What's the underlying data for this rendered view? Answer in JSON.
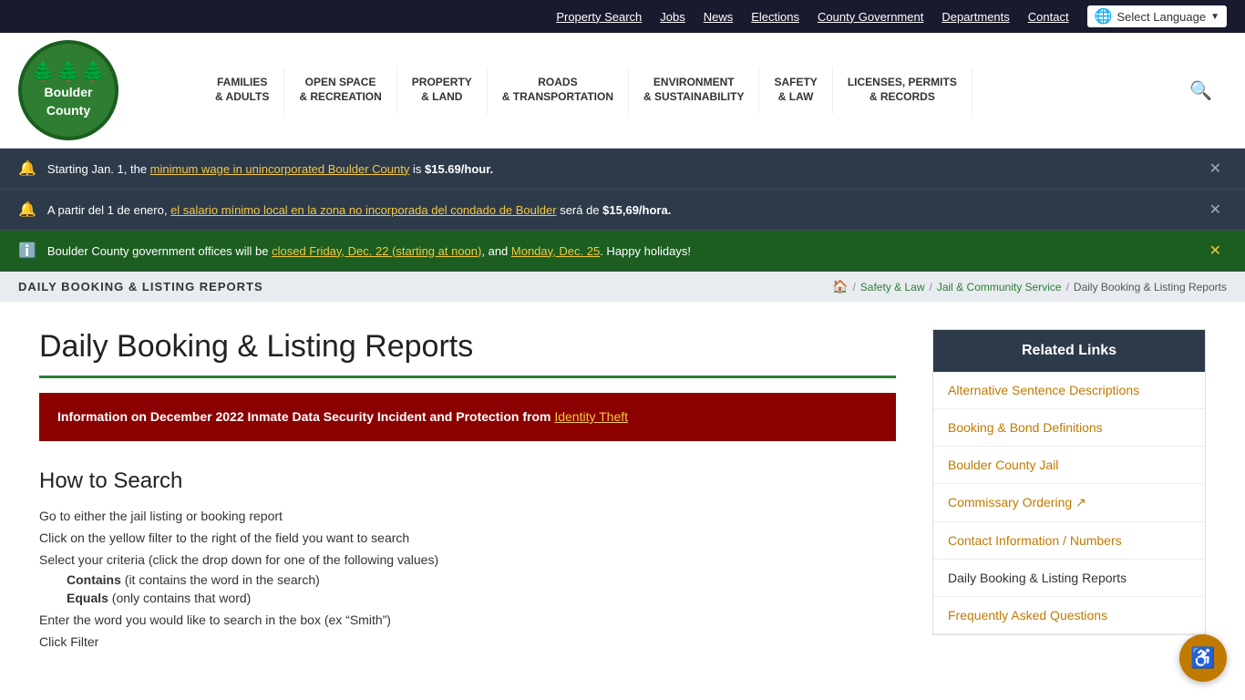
{
  "topNav": {
    "links": [
      {
        "label": "Property Search",
        "href": "#"
      },
      {
        "label": "Jobs",
        "href": "#"
      },
      {
        "label": "News",
        "href": "#"
      },
      {
        "label": "Elections",
        "href": "#"
      },
      {
        "label": "County Government",
        "href": "#"
      },
      {
        "label": "Departments",
        "href": "#"
      },
      {
        "label": "Contact",
        "href": "#"
      }
    ],
    "languageSelector": "Select Language"
  },
  "logo": {
    "line1": "Boulder",
    "line2": "County"
  },
  "mainNav": {
    "items": [
      {
        "line1": "FAMILIES",
        "line2": "& ADULTS"
      },
      {
        "line1": "OPEN SPACE",
        "line2": "& RECREATION"
      },
      {
        "line1": "PROPERTY",
        "line2": "& LAND"
      },
      {
        "line1": "ROADS",
        "line2": "& TRANSPORTATION"
      },
      {
        "line1": "ENVIRONMENT",
        "line2": "& SUSTAINABILITY"
      },
      {
        "line1": "SAFETY",
        "line2": "& LAW"
      },
      {
        "line1": "LICENSES, PERMITS",
        "line2": "& RECORDS"
      }
    ]
  },
  "alerts": [
    {
      "type": "bell",
      "text1": "Starting Jan. 1, the ",
      "linkText": "minimum wage in unincorporated Boulder County",
      "text2": " is ",
      "boldText": "$15.69/hour.",
      "bg": "dark"
    },
    {
      "type": "bell",
      "text1": "A partir del 1 de enero, ",
      "linkText": "el salario mínimo local en la zona no incorporada del condado de Boulder",
      "text2": " será de ",
      "boldText": "$15,69/hora.",
      "bg": "dark"
    },
    {
      "type": "info",
      "text1": "Boulder County government offices will be ",
      "linkText1": "closed Friday, Dec. 22 (starting at noon)",
      "text2": ", and ",
      "linkText2": "Monday, Dec. 25",
      "text3": ". Happy holidays!",
      "bg": "green"
    }
  ],
  "breadcrumb": {
    "pageTitle": "DAILY BOOKING & LISTING REPORTS",
    "homeLabel": "🏠",
    "items": [
      {
        "label": "Safety & Law",
        "href": "#"
      },
      {
        "label": "Jail & Community Service",
        "href": "#"
      },
      {
        "label": "Daily Booking & Listing Reports",
        "href": ""
      }
    ]
  },
  "mainContent": {
    "pageTitle": "Daily Booking & Listing Reports",
    "redAlert": {
      "text1": "Information on December 2022 Inmate Data Security Incident and Protection from ",
      "linkText": "Identity Theft"
    },
    "howToSearch": {
      "title": "How to Search",
      "steps": [
        "Go to either the jail listing or booking report",
        "Click on the yellow filter to the right of the field you want to search",
        "Select your criteria (click the drop down for one of the following values)",
        "Enter the word you would like to search in the box (ex “Smith”)",
        "Click Filter"
      ],
      "subSteps": [
        {
          "label": "Contains",
          "desc": " (it contains the word in the search)"
        },
        {
          "label": "Equals",
          "desc": " (only contains that word)"
        }
      ]
    }
  },
  "sidebar": {
    "relatedLinksTitle": "Related Links",
    "links": [
      {
        "label": "Alternative Sentence Descriptions",
        "active": false
      },
      {
        "label": "Booking & Bond Definitions",
        "active": false
      },
      {
        "label": "Boulder County Jail",
        "active": false
      },
      {
        "label": "Commissary Ordering",
        "external": true,
        "active": false
      },
      {
        "label": "Contact Information / Numbers",
        "active": false
      },
      {
        "label": "Daily Booking & Listing Reports",
        "active": true
      },
      {
        "label": "Frequently Asked Questions",
        "active": false
      }
    ]
  },
  "accessibility": {
    "label": "♿"
  }
}
